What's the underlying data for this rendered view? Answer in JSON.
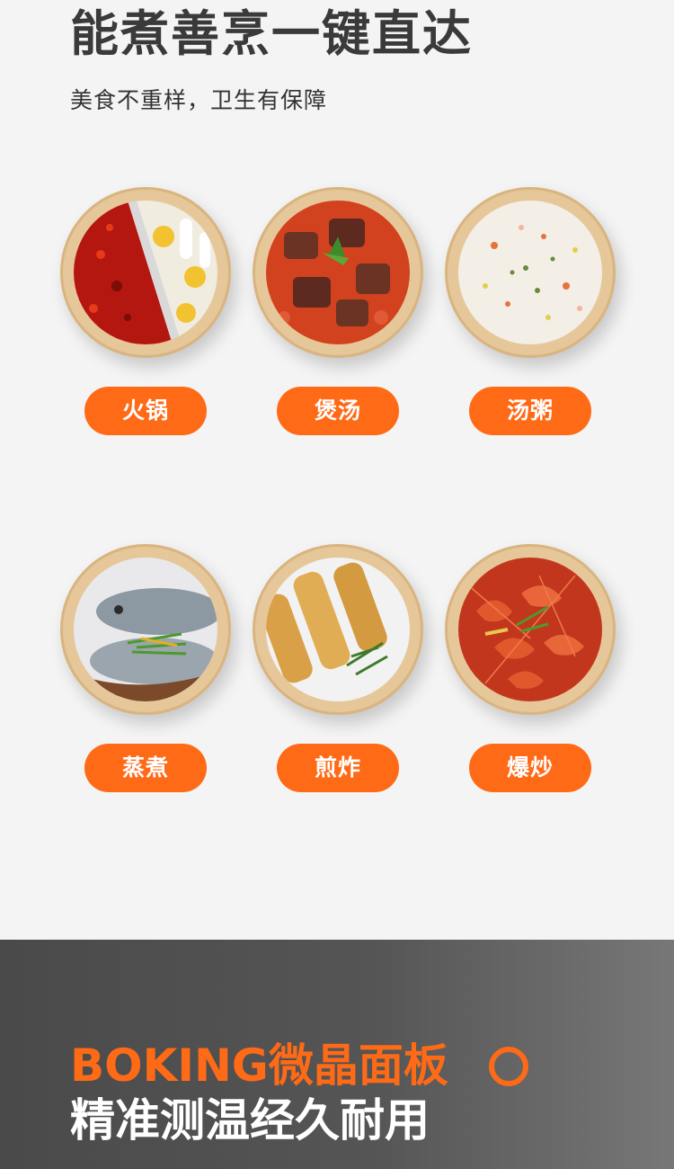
{
  "header": {
    "title": "能煮善烹一键直达",
    "subtitle": "美食不重样，卫生有保障"
  },
  "dishes": [
    {
      "label": "火锅",
      "icon": "hotpot-image"
    },
    {
      "label": "煲汤",
      "icon": "beef-stew-image"
    },
    {
      "label": "汤粥",
      "icon": "congee-image"
    },
    {
      "label": "蒸煮",
      "icon": "steamed-fish-image"
    },
    {
      "label": "煎炸",
      "icon": "spring-rolls-image"
    },
    {
      "label": "爆炒",
      "icon": "stir-fried-shrimp-image"
    }
  ],
  "footer": {
    "brand": "BOKING微晶面板",
    "tagline": "精准测温经久耐用"
  },
  "colors": {
    "accent": "#ff6a17",
    "title": "#3a3a3a",
    "footer_bg": "#4a4a4a"
  }
}
